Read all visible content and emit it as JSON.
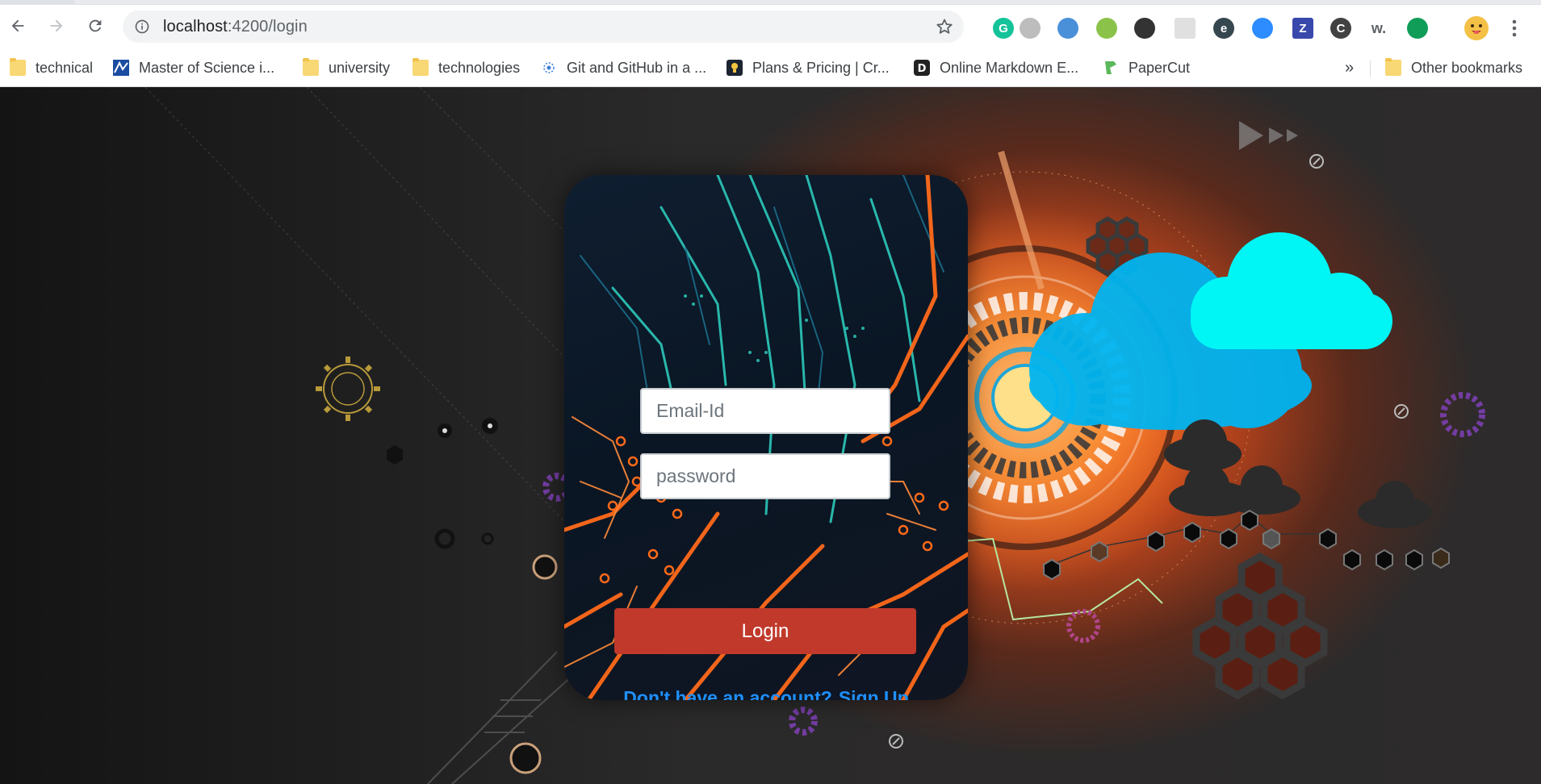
{
  "browser": {
    "url_host": "localhost",
    "url_path": ":4200/login",
    "bookmarks": [
      {
        "label": "technical",
        "icon": "folder-icon"
      },
      {
        "label": "Master of Science i...",
        "icon": "university-logo-icon"
      },
      {
        "label": "university",
        "icon": "folder-icon"
      },
      {
        "label": "technologies",
        "icon": "folder-icon"
      },
      {
        "label": "Git and GitHub in a ...",
        "icon": "git-site-icon"
      },
      {
        "label": "Plans & Pricing | Cr...",
        "icon": "lightbulb-icon"
      },
      {
        "label": "Online Markdown E...",
        "icon": "d-logo-icon"
      },
      {
        "label": "PaperCut",
        "icon": "papercut-icon"
      }
    ],
    "overflow_label": "»",
    "other_bookmarks": "Other bookmarks",
    "extensions": [
      {
        "name": "grammarly-icon",
        "glyph": "G",
        "color": "#15c39a"
      },
      {
        "name": "circle-extension-icon",
        "glyph": "",
        "color": "#bdbdbd"
      },
      {
        "name": "translate-extension-icon",
        "glyph": "",
        "color": "#4a90d9"
      },
      {
        "name": "ticket-extension-icon",
        "glyph": "",
        "color": "#8bc34a"
      },
      {
        "name": "spiral-extension-icon",
        "glyph": "",
        "color": "#333333"
      },
      {
        "name": "page-extension-icon",
        "glyph": "",
        "color": "#e0e0e0"
      },
      {
        "name": "e-extension-icon",
        "glyph": "e",
        "color": "#37474f"
      },
      {
        "name": "zoom-extension-icon",
        "glyph": "",
        "color": "#2d8cff"
      },
      {
        "name": "z-extension-icon",
        "glyph": "Z",
        "color": "#3949ab"
      },
      {
        "name": "c-extension-icon",
        "glyph": "C",
        "color": "#424242"
      },
      {
        "name": "w-extension-icon",
        "glyph": "w.",
        "color": "#ffffff"
      },
      {
        "name": "chat-bubble-extension-icon",
        "glyph": "",
        "color": "#0f9d58"
      }
    ]
  },
  "login": {
    "email_placeholder": "Email-Id",
    "password_placeholder": "password",
    "login_button": "Login",
    "no_account_text": "Don't have an account?",
    "signup_link": "Sign Up"
  },
  "colors": {
    "login_button": "#c0392b",
    "link": "#1e90ff",
    "cloud_primary": "#00b4f0",
    "cloud_secondary": "#00ffff",
    "glow": "#ff7a2a"
  }
}
